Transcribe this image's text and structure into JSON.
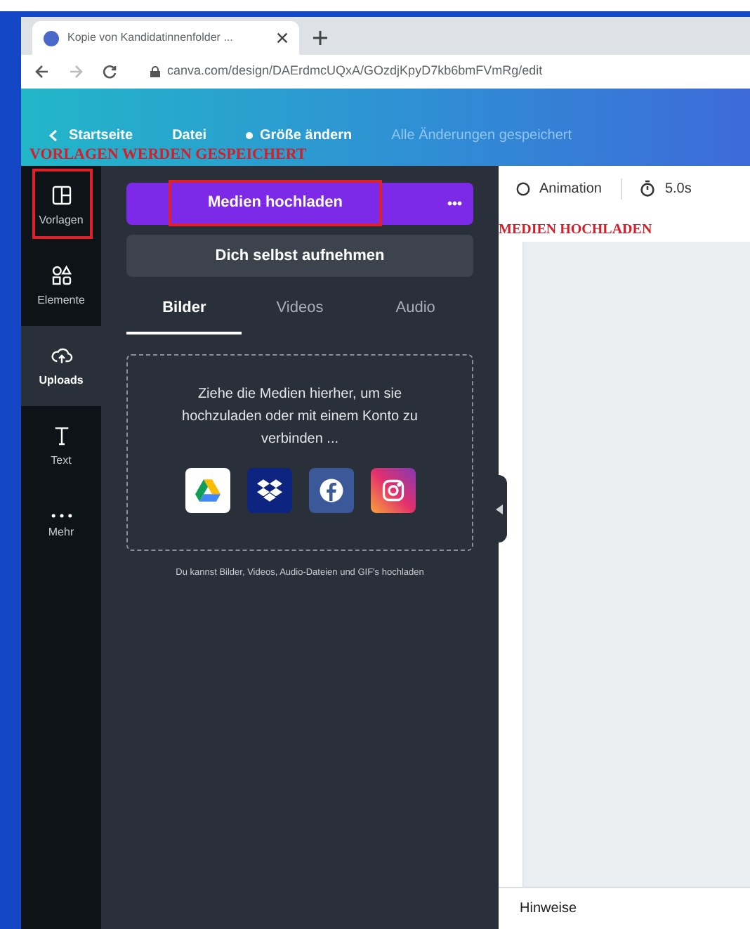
{
  "browser": {
    "tab_title": "Kopie von Kandidatinnenfolder ...",
    "url": "canva.com/design/DAErdmcUQxA/GOzdjKpyD7kb6bmFVmRg/edit"
  },
  "header": {
    "back": "Startseite",
    "items": [
      "Datei",
      "Größe ändern"
    ],
    "status": "Alle Änderungen gespeichert"
  },
  "annotations": {
    "templates_note": "VORLAGEN WERDEN GESPEICHERT",
    "upload_note": "MEDIEN HOCHLADEN"
  },
  "sidebar": {
    "items": [
      {
        "kind": "templates",
        "label": "Vorlagen",
        "selected": false,
        "marked": true
      },
      {
        "kind": "elements",
        "label": "Elemente",
        "selected": false,
        "marked": false
      },
      {
        "kind": "uploads",
        "label": "Uploads",
        "selected": true,
        "marked": false
      },
      {
        "kind": "text",
        "label": "Text",
        "selected": false,
        "marked": false
      },
      {
        "kind": "more",
        "label": "Mehr",
        "selected": false,
        "marked": false
      }
    ]
  },
  "panel": {
    "upload_button": "Medien hochladen",
    "more_button": "•••",
    "record_button": "Dich selbst aufnehmen",
    "tabs": [
      {
        "label": "Bilder",
        "selected": true
      },
      {
        "label": "Videos",
        "selected": false
      },
      {
        "label": "Audio",
        "selected": false
      }
    ],
    "dropzone_text": "Ziehe die Medien hierher, um sie hochzuladen oder mit einem Konto zu verbinden ...",
    "services": [
      {
        "kind": "drive"
      },
      {
        "kind": "dropbox"
      },
      {
        "kind": "facebook"
      },
      {
        "kind": "instagram"
      }
    ],
    "hint": "Du kannst Bilder, Videos, Audio-Dateien und GIF's hochladen"
  },
  "canvas": {
    "animation": "Animation",
    "duration": "5.0s",
    "notes": "Hinweise"
  }
}
